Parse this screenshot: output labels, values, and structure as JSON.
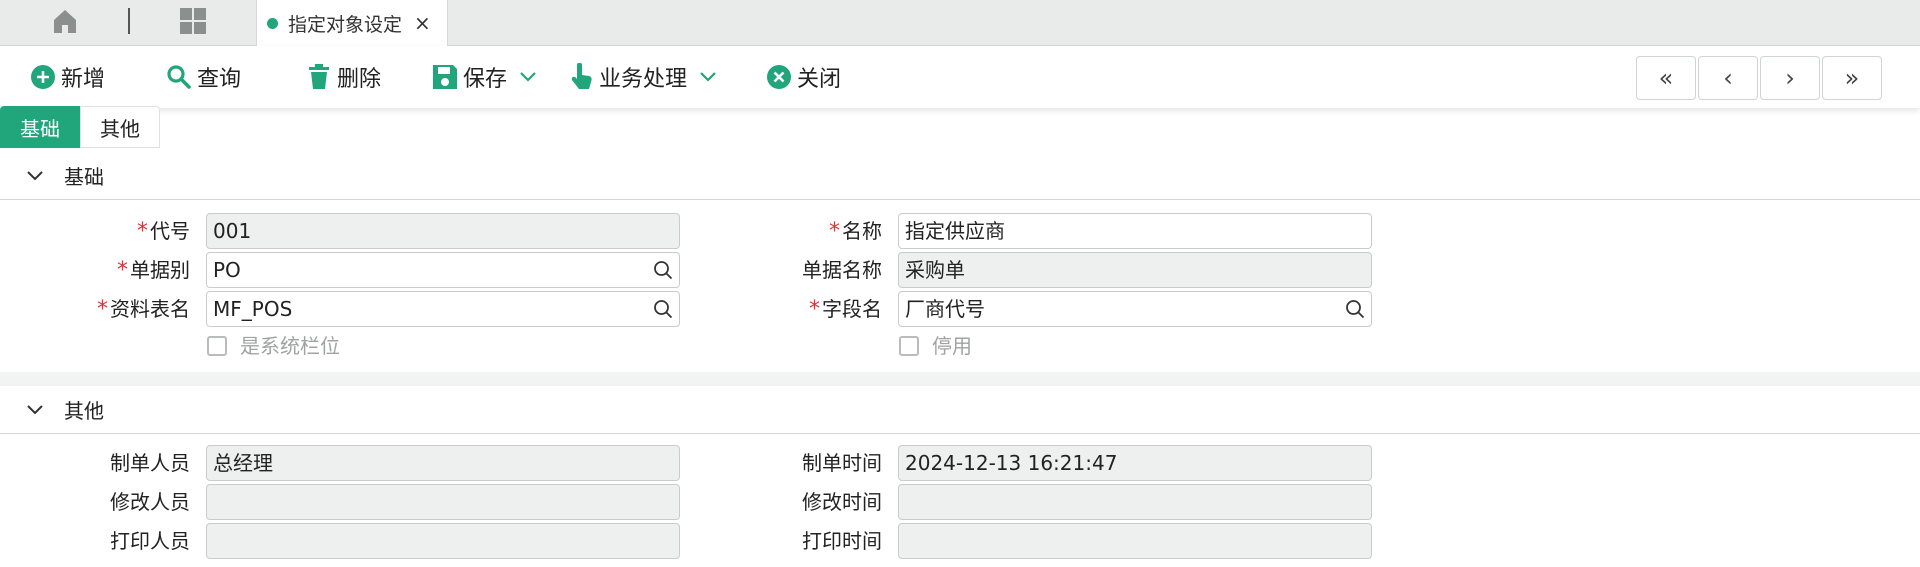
{
  "tabbar": {
    "active_tab": "指定对象设定",
    "close_glyph": "×",
    "icons": [
      "home-icon",
      "apps-grid-icon"
    ]
  },
  "toolbar": {
    "add": "新增",
    "query": "查询",
    "delete": "删除",
    "save": "保存",
    "business": "业务处理",
    "close": "关闭",
    "nav": {
      "first": "«",
      "prev": "‹",
      "next": "›",
      "last": "»"
    }
  },
  "subtabs": {
    "basic": "基础",
    "other": "其他"
  },
  "sections": {
    "basic": {
      "title": "基础",
      "code_label": "代号",
      "code_value": "001",
      "name_label": "名称",
      "name_value": "指定供应商",
      "doc_type_label": "单据别",
      "doc_type_value": "PO",
      "doc_name_label": "单据名称",
      "doc_name_value": "采购单",
      "table_label": "资料表名",
      "table_value": "MF_POS",
      "field_label": "字段名",
      "field_value": "厂商代号",
      "system_field_label": "是系统栏位",
      "disabled_label": "停用"
    },
    "other": {
      "title": "其他",
      "creator_label": "制单人员",
      "creator_value": "总经理",
      "created_time_label": "制单时间",
      "created_time_value": "2024-12-13 16:21:47",
      "modifier_label": "修改人员",
      "modifier_value": "",
      "modified_time_label": "修改时间",
      "modified_time_value": "",
      "printer_label": "打印人员",
      "printer_value": "",
      "printed_time_label": "打印时间",
      "printed_time_value": ""
    }
  },
  "required_mark": "*",
  "colors": {
    "accent": "#20a67a",
    "required": "#e0303a"
  }
}
